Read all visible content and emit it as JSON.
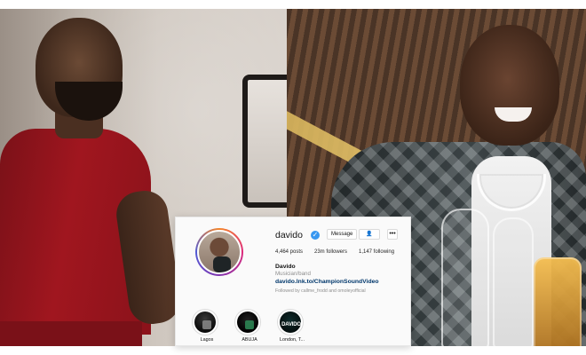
{
  "profile": {
    "username": "davido",
    "verified_badge_icon": "verified-check-icon",
    "buttons": {
      "message": "Message",
      "follow_icon": "person-chevron-icon",
      "follow_label": "👤",
      "more_label": "•••"
    },
    "stats": {
      "posts": "4,464 posts",
      "followers": "23m followers",
      "following": "1,147 following"
    },
    "bio": {
      "name": "Davido",
      "category": "Musician/band",
      "link": "davido.lnk.to/ChampionSoundVideo",
      "followed_by": "Followed by callme_frodd and omoleyofficial"
    },
    "highlights": [
      {
        "label": "Lagos"
      },
      {
        "label": "ABUJA"
      },
      {
        "label": "London, T...",
        "cover_text": "DAVIDO"
      }
    ]
  }
}
